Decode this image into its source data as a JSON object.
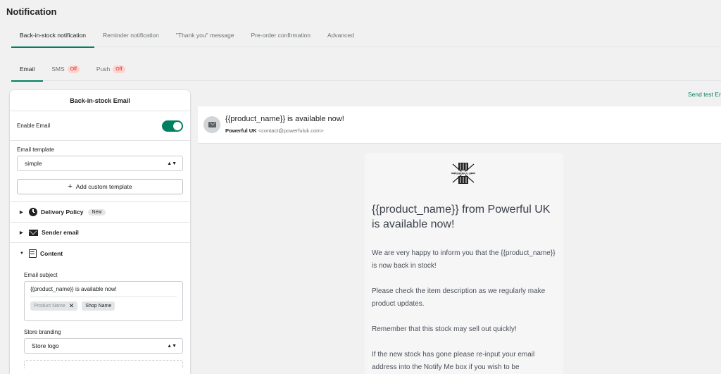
{
  "page": {
    "title": "Notification"
  },
  "top_tabs": [
    {
      "label": "Back-in-stock notification",
      "active": true
    },
    {
      "label": "Reminder notification",
      "active": false
    },
    {
      "label": "\"Thank you\" message",
      "active": false
    },
    {
      "label": "Pre-order confirmation",
      "active": false
    },
    {
      "label": "Advanced",
      "active": false
    }
  ],
  "sub_tabs": [
    {
      "label": "Email",
      "badge": "",
      "active": true
    },
    {
      "label": "SMS",
      "badge": "Off",
      "active": false
    },
    {
      "label": "Push",
      "badge": "Off",
      "active": false
    }
  ],
  "left_panel": {
    "title": "Back-in-stock Email",
    "enable_label": "Enable Email",
    "enable_on": true,
    "template_label": "Email template",
    "template_value": "simple",
    "add_template_label": "Add custom template",
    "sections": [
      {
        "label": "Delivery Policy",
        "badge": "New",
        "icon": "clock-icon",
        "expanded": false
      },
      {
        "label": "Sender email",
        "badge": "",
        "icon": "envelope-icon",
        "expanded": false
      },
      {
        "label": "Content",
        "badge": "",
        "icon": "document-icon",
        "expanded": true
      }
    ],
    "content": {
      "subject_label": "Email subject",
      "subject_value": "{{product_name}} is available now!",
      "chips": [
        "Product Name",
        "Shop Name"
      ],
      "branding_label": "Store branding",
      "branding_value": "Store logo"
    }
  },
  "preview": {
    "send_test_label": "Send test Er",
    "subject": "{{product_name}} is available now!",
    "from_name": "Powerful UK",
    "from_email": "<contact@powerfuluk.com>",
    "logo_text": "POWERFUL UK",
    "heading": "{{product_name}} from Powerful UK is available now!",
    "paragraphs": [
      "We are very happy to inform you that the {{product_name}} is now back in stock!",
      "Please check the item description as we regularly make product updates.",
      "Remember that this stock may sell out quickly!",
      "If the new stock has gone please re-input your email address into the Notify Me box if you wish to be"
    ]
  },
  "colors": {
    "accent": "#008060",
    "badge_off_bg": "#fed3d1",
    "badge_off_text": "#d82c0d"
  }
}
